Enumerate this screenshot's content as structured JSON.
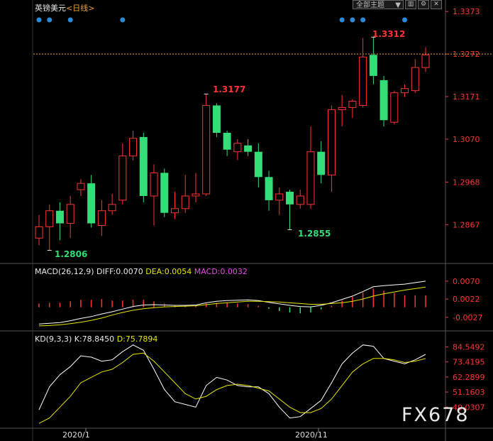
{
  "header": {
    "symbol": "英镑美元",
    "period": "<日线>",
    "theme_select": "全部主题",
    "theme_arrow": "▼"
  },
  "toolbar_icons": [
    "chart-type-icon",
    "settings-icon",
    "close-icon"
  ],
  "macd": {
    "label": "MACD(26,12,9)",
    "diff": "DIFF:0.0070",
    "dea": "DEA:0.0054",
    "macd": "MACD:0.0032"
  },
  "kd": {
    "label": "KD(9,3,3)",
    "k": "K:78.8450",
    "d": "D:75.7894"
  },
  "watermark": "FX678",
  "colors": {
    "up": "#ff3333",
    "down": "#33dd77",
    "axis": "#ff3333",
    "macd_line": "#ffffff",
    "dea_line": "#e6e600",
    "event_dot": "#2a8bd8",
    "ref_line": "#e8a03a"
  },
  "chart_data": [
    {
      "type": "candlestick",
      "title": "英镑美元 <日线>",
      "y_ticks": [
        "1.3373",
        "1.3272",
        "1.3171",
        "1.3070",
        "1.2968",
        "1.2867"
      ],
      "ylim": [
        1.279,
        1.338
      ],
      "reference_line": 1.3272,
      "x_ticks": [
        "2020/1",
        "2020/11"
      ],
      "annotations": [
        {
          "label": "1.3177",
          "value": 1.3177,
          "kind": "high"
        },
        {
          "label": "1.2806",
          "value": 1.2806,
          "kind": "low"
        },
        {
          "label": "1.3312",
          "value": 1.3312,
          "kind": "high"
        },
        {
          "label": "1.2855",
          "value": 1.2855,
          "kind": "low"
        }
      ],
      "event_markers": [
        0,
        1,
        3,
        8,
        29,
        30,
        31,
        35
      ],
      "candles": [
        {
          "o": 1.2835,
          "h": 1.289,
          "l": 1.2818,
          "c": 1.2862
        },
        {
          "o": 1.2862,
          "h": 1.2915,
          "l": 1.2806,
          "c": 1.29
        },
        {
          "o": 1.29,
          "h": 1.292,
          "l": 1.283,
          "c": 1.287
        },
        {
          "o": 1.287,
          "h": 1.2935,
          "l": 1.2835,
          "c": 1.2915
        },
        {
          "o": 1.295,
          "h": 1.2975,
          "l": 1.2935,
          "c": 1.2965
        },
        {
          "o": 1.2965,
          "h": 1.2985,
          "l": 1.286,
          "c": 1.287
        },
        {
          "o": 1.2865,
          "h": 1.2925,
          "l": 1.284,
          "c": 1.29
        },
        {
          "o": 1.29,
          "h": 1.294,
          "l": 1.289,
          "c": 1.2915
        },
        {
          "o": 1.2925,
          "h": 1.306,
          "l": 1.2915,
          "c": 1.303
        },
        {
          "o": 1.303,
          "h": 1.309,
          "l": 1.302,
          "c": 1.3072
        },
        {
          "o": 1.3075,
          "h": 1.3085,
          "l": 1.292,
          "c": 1.2935
        },
        {
          "o": 1.2935,
          "h": 1.301,
          "l": 1.2865,
          "c": 1.299
        },
        {
          "o": 1.299,
          "h": 1.3,
          "l": 1.2885,
          "c": 1.2895
        },
        {
          "o": 1.2895,
          "h": 1.2945,
          "l": 1.288,
          "c": 1.2905
        },
        {
          "o": 1.2905,
          "h": 1.2985,
          "l": 1.2895,
          "c": 1.2935
        },
        {
          "o": 1.2935,
          "h": 1.299,
          "l": 1.292,
          "c": 1.294
        },
        {
          "o": 1.294,
          "h": 1.3177,
          "l": 1.2935,
          "c": 1.315
        },
        {
          "o": 1.315,
          "h": 1.3155,
          "l": 1.3075,
          "c": 1.3085
        },
        {
          "o": 1.3085,
          "h": 1.309,
          "l": 1.303,
          "c": 1.3045
        },
        {
          "o": 1.304,
          "h": 1.307,
          "l": 1.302,
          "c": 1.306
        },
        {
          "o": 1.3055,
          "h": 1.307,
          "l": 1.303,
          "c": 1.304
        },
        {
          "o": 1.304,
          "h": 1.306,
          "l": 1.2955,
          "c": 1.298
        },
        {
          "o": 1.298,
          "h": 1.2995,
          "l": 1.29,
          "c": 1.2925
        },
        {
          "o": 1.2925,
          "h": 1.2955,
          "l": 1.289,
          "c": 1.294
        },
        {
          "o": 1.2945,
          "h": 1.295,
          "l": 1.2855,
          "c": 1.2915
        },
        {
          "o": 1.2915,
          "h": 1.295,
          "l": 1.2905,
          "c": 1.2935
        },
        {
          "o": 1.2915,
          "h": 1.31,
          "l": 1.2905,
          "c": 1.304
        },
        {
          "o": 1.304,
          "h": 1.3065,
          "l": 1.2965,
          "c": 1.2985
        },
        {
          "o": 1.2985,
          "h": 1.315,
          "l": 1.2945,
          "c": 1.314
        },
        {
          "o": 1.314,
          "h": 1.3175,
          "l": 1.31,
          "c": 1.3145
        },
        {
          "o": 1.3145,
          "h": 1.3165,
          "l": 1.312,
          "c": 1.316
        },
        {
          "o": 1.315,
          "h": 1.331,
          "l": 1.3145,
          "c": 1.3265
        },
        {
          "o": 1.327,
          "h": 1.3312,
          "l": 1.32,
          "c": 1.322
        },
        {
          "o": 1.321,
          "h": 1.322,
          "l": 1.31,
          "c": 1.3115
        },
        {
          "o": 1.311,
          "h": 1.3185,
          "l": 1.3105,
          "c": 1.318
        },
        {
          "o": 1.318,
          "h": 1.32,
          "l": 1.317,
          "c": 1.319
        },
        {
          "o": 1.3185,
          "h": 1.326,
          "l": 1.318,
          "c": 1.324
        },
        {
          "o": 1.324,
          "h": 1.3288,
          "l": 1.323,
          "c": 1.327
        }
      ]
    },
    {
      "type": "bar+line",
      "title": "MACD(26,12,9)",
      "y_ticks": [
        "0.0070",
        "0.0022",
        "-0.0027"
      ],
      "ylim": [
        -0.0052,
        0.0085
      ],
      "series": [
        {
          "name": "DIFF",
          "values": [
            -0.0045,
            -0.0043,
            -0.0041,
            -0.0036,
            -0.003,
            -0.0025,
            -0.0018,
            -0.0012,
            -0.0005,
            0.0002,
            0.0006,
            0.0007,
            0.0006,
            0.0005,
            0.0005,
            0.0006,
            0.0012,
            0.0016,
            0.0018,
            0.0019,
            0.002,
            0.0018,
            0.0013,
            0.0009,
            0.0005,
            0.0002,
            0.0001,
            0.0005,
            0.0012,
            0.0021,
            0.003,
            0.0042,
            0.0055,
            0.0058,
            0.006,
            0.0062,
            0.0066,
            0.007
          ]
        },
        {
          "name": "DEA",
          "values": [
            -0.005,
            -0.0049,
            -0.0047,
            -0.0044,
            -0.004,
            -0.0035,
            -0.0029,
            -0.0021,
            -0.0014,
            -0.0008,
            -0.0004,
            -0.0001,
            0.0001,
            0.0002,
            0.0003,
            0.0004,
            0.0007,
            0.001,
            0.0012,
            0.0014,
            0.0016,
            0.0016,
            0.0015,
            0.0014,
            0.0012,
            0.001,
            0.0008,
            0.0008,
            0.001,
            0.0012,
            0.0016,
            0.0022,
            0.003,
            0.0036,
            0.0041,
            0.0046,
            0.005,
            0.0054
          ]
        },
        {
          "name": "MACD",
          "values": [
            0.001,
            0.0012,
            0.0012,
            0.0016,
            0.002,
            0.002,
            0.0022,
            0.0018,
            0.0018,
            0.002,
            0.002,
            0.0016,
            0.001,
            0.0006,
            0.0004,
            0.0004,
            0.001,
            0.0012,
            0.0012,
            0.001,
            0.0008,
            0.0004,
            -0.0004,
            -0.001,
            -0.0014,
            -0.0016,
            -0.0014,
            -0.0006,
            0.0004,
            0.0018,
            0.0028,
            0.004,
            0.005,
            0.0044,
            0.0038,
            0.0032,
            0.0032,
            0.0032
          ]
        }
      ]
    },
    {
      "type": "line",
      "title": "KD(9,3,3)",
      "y_ticks": [
        "84.5492",
        "73.4195",
        "62.2899",
        "51.1603",
        "40.0307"
      ],
      "ylim": [
        26,
        89
      ],
      "series": [
        {
          "name": "K",
          "values": [
            38,
            55,
            64,
            70,
            78,
            77,
            74,
            75,
            81,
            86,
            82,
            68,
            53,
            44,
            42,
            40,
            56,
            62,
            60,
            56,
            55,
            55,
            50,
            40,
            32,
            33,
            39,
            45,
            58,
            72,
            80,
            86,
            85,
            76,
            74,
            72,
            75,
            79
          ]
        },
        {
          "name": "D",
          "values": [
            28,
            32,
            40,
            48,
            58,
            62,
            66,
            68,
            73,
            79,
            80,
            74,
            66,
            58,
            50,
            46,
            48,
            53,
            56,
            57,
            56,
            54,
            52,
            46,
            40,
            36,
            36,
            39,
            46,
            56,
            66,
            72,
            76,
            76,
            75,
            73,
            74,
            76
          ]
        }
      ]
    }
  ]
}
